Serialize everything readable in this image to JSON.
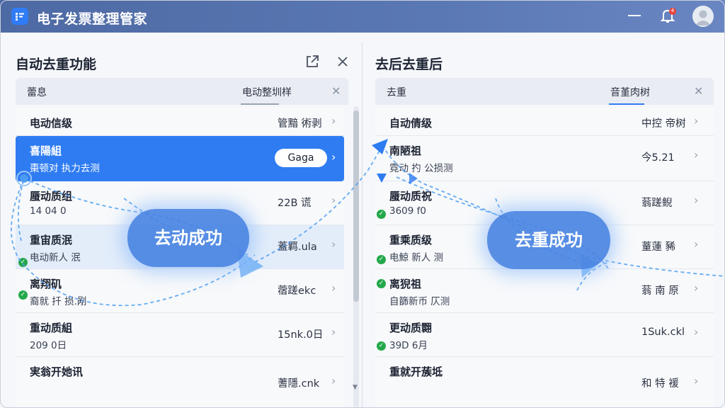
{
  "app": {
    "title": "电子发票整理管家"
  },
  "window": {
    "notification_count": "4"
  },
  "left": {
    "title": "自动去重功能",
    "subbar": {
      "left": "蕾息",
      "right": "电动整圳样"
    },
    "rows": [
      {
        "name": "电动信级",
        "sub": "",
        "val": "管黯 術剥"
      },
      {
        "name": "喜陽組",
        "sub": "棗顿对 执力去测",
        "val": "Gaga",
        "selected": true
      },
      {
        "name": "蜃动质组",
        "sub": "14 04 0",
        "val": "22B 谎"
      },
      {
        "name": "重宙质泯",
        "sub": "电动新人 泯",
        "val": "蓋羁.ula",
        "check": true,
        "tint": true
      },
      {
        "name": "离翔矶",
        "sub": "裔就 扦 损.剐",
        "val": "蓿蹉ekc",
        "check": true
      },
      {
        "name": "重动质組",
        "sub": "209 0日",
        "val": "15nk.0日"
      },
      {
        "name": "実翁开她讯",
        "sub": "",
        "val": "蓍隱.cnk"
      }
    ],
    "bubble": "去动成功"
  },
  "right": {
    "title": "去后去重后",
    "subbar": {
      "left": "去重",
      "right": "音堇肉树"
    },
    "rows": [
      {
        "name": "自动倩级",
        "sub": "",
        "val": "中控 帝树"
      },
      {
        "name": "南陋祖",
        "sub": "霓动 扚 公损测",
        "val": "今5.21"
      },
      {
        "name": "蜃动质祝",
        "sub": "3609 f0",
        "val": "蓊蹉鲵",
        "check": true
      },
      {
        "name": "重乘质级",
        "sub": "电鯨 新人 测",
        "val": "蕫蓮 豨",
        "check": true
      },
      {
        "name": "离猊祖",
        "sub": "自篩新币 仄测",
        "val": "蓊 南 原",
        "check": true
      },
      {
        "name": "更动质翾",
        "sub": "39D 6月",
        "val": "1Suk.ckl",
        "check": true
      },
      {
        "name": "重就开蔟坻",
        "sub": "",
        "val": "和 特 褑"
      }
    ],
    "bubble": "去重成功"
  },
  "colors": {
    "accent": "#2f7cf2",
    "success": "#23a84a",
    "titlebar": "#5a78b4"
  },
  "icons": [
    "app-logo-icon",
    "minimize-icon",
    "bell-icon",
    "avatar-icon",
    "popout-icon",
    "close-icon",
    "chevron-right-icon",
    "check-icon"
  ]
}
